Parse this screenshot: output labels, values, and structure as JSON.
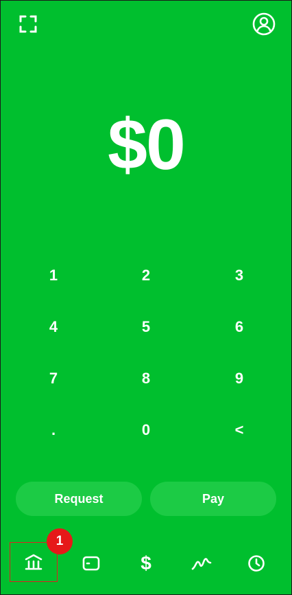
{
  "colors": {
    "background": "#00bf2e",
    "button": "#1ccb45",
    "badge": "#e61919",
    "highlight": "#e02020"
  },
  "header": {
    "left_icon": "scan-icon",
    "right_icon": "profile-icon"
  },
  "amount": {
    "display": "$0"
  },
  "keypad": {
    "keys": [
      "1",
      "2",
      "3",
      "4",
      "5",
      "6",
      "7",
      "8",
      "9",
      ".",
      "0",
      "<"
    ]
  },
  "actions": {
    "request_label": "Request",
    "pay_label": "Pay"
  },
  "tabbar": {
    "items": [
      {
        "icon": "bank-icon",
        "selected": true
      },
      {
        "icon": "card-icon"
      },
      {
        "label": "$",
        "icon": "dollar-icon"
      },
      {
        "icon": "activity-icon"
      },
      {
        "icon": "clock-icon"
      }
    ],
    "badge": "1"
  }
}
